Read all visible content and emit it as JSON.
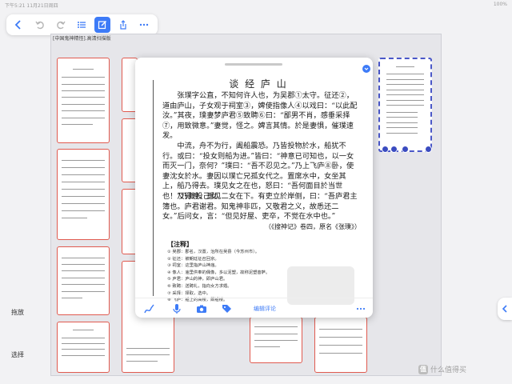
{
  "status_bar": {
    "left": "下午5:21  11月21日周四",
    "right": "100%"
  },
  "toolbar": {
    "items": [
      {
        "name": "back-icon"
      },
      {
        "name": "undo-icon"
      },
      {
        "name": "redo-icon"
      },
      {
        "name": "outline-list-icon"
      },
      {
        "name": "edit-icon"
      },
      {
        "name": "share-icon"
      },
      {
        "name": "more-icon"
      }
    ],
    "accent_color": "#3d7bf7"
  },
  "canvas": {
    "label": "[中国鬼神精怪].高清扫描版"
  },
  "document": {
    "title": "谈 经 庐 山",
    "paragraphs": [
      "张璞字公直，不知何许人也，为吴郡①太守。征还②，道由庐山，子女观于祠室③，婢使指像人④以戏曰：“以此配汝。”其夜，璞妻梦庐君⑤致聘⑥曰：“鄙男不肖，感垂采择⑦，用致微意。”妻觉，怪之。婢言其情。於是妻惧，催璞速发。",
      "中流，舟不为行，阖船震恐。乃皆投物於水，船犹不行。或曰：“投女则船为进。”皆曰：“神意已可知也，以一女而灭一门，奈何？”璞曰：“吾不忍见之。”乃上飞庐⑧卧，使妻沈女於水。妻因以璞亡兄孤女代之。置席水中，女坐其上，船乃得去。璞见女之在也，怒曰：“吾何面目於当世也！”乃复投己女。",
      "及得渡，遥见二女在下。有吏立於岸侧，曰：“吾庐君主簿也。庐君谢君。知鬼神非匹，又敬君之义，故悉还二女。”后问女，言：“但见好屋、吏卒，不觉在水中也。”"
    ],
    "source": "（《搜神记》卷四，原名《张璞》）",
    "notes_heading": "【注释】",
    "notes": [
      "① 吴郡：郡名，汉置，治所在吴县（今苏州市）。",
      "② 征还：被朝廷征召回京。",
      "③ 祠室：这里指庐山神庙。",
      "④ 像人：庙里供奉的偶像，多以泥塑，故称泥塑菩萨。",
      "⑤ 庐君：庐山的神，即庐山君。",
      "⑥ 致聘：送聘礼，指向女方求婚。",
      "⑦ 采择：择取，选中。",
      "⑧ 飞庐：船上的高楼，即船楼。"
    ],
    "bottom_bar": {
      "items": [
        {
          "name": "pen-icon"
        },
        {
          "name": "microphone-icon"
        },
        {
          "name": "camera-icon"
        },
        {
          "name": "tag-icon"
        },
        {
          "name": "more-icon"
        }
      ],
      "comment_label": "编辑评论"
    }
  },
  "sidebar": {
    "drag_label": "拖放",
    "select_label": "选择"
  },
  "watermark": {
    "logo": "值",
    "text": "什么值得买"
  }
}
